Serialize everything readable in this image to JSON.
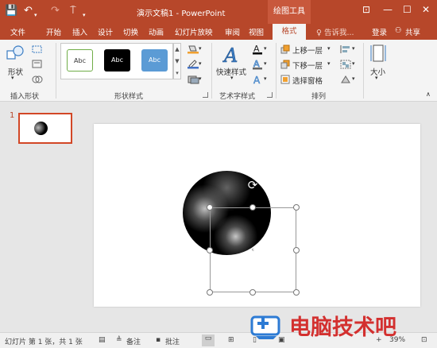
{
  "title_bar": {
    "save_icon": "💾",
    "undo_icon": "↶",
    "redo_icon": "↷",
    "customize_icon": "⍑",
    "title": "演示文稿1 - PowerPoint",
    "context_group": "绘图工具",
    "ribbon_display_icon": "⊡",
    "minimize_icon": "—",
    "maximize_icon": "☐",
    "close_icon": "✕"
  },
  "tabs": {
    "items": [
      "文件",
      "开始",
      "插入",
      "设计",
      "切换",
      "动画",
      "幻灯片放映",
      "审阅",
      "视图"
    ],
    "active": "格式",
    "tell_me": "告诉我...",
    "login": "登录",
    "share": "共享"
  },
  "ribbon": {
    "insert_shapes": {
      "shapes_label": "形状",
      "group_label": "插入形状"
    },
    "shape_styles": {
      "presets": [
        "Abc",
        "Abc",
        "Abc"
      ],
      "group_label": "形状样式"
    },
    "wordart_styles": {
      "quick_styles_label": "快速样式",
      "group_label": "艺术字样式"
    },
    "arrange": {
      "bring_forward": "上移一层",
      "send_backward": "下移一层",
      "selection_pane": "选择窗格",
      "group_label": "排列"
    },
    "size": {
      "label": "大小"
    }
  },
  "slides_pane": {
    "slide_number": "1"
  },
  "status_bar": {
    "slide_info": "幻灯片 第 1 张，共 1 张",
    "notes": "备注",
    "comments": "批注",
    "zoom": "39%"
  },
  "watermark": {
    "text": "电脑技术吧"
  },
  "colors": {
    "accent": "#b7472a",
    "preset_white_border": "#70ad47",
    "preset_black": "#000000",
    "preset_blue": "#5b9bd5",
    "watermark_red": "#d3302f"
  }
}
